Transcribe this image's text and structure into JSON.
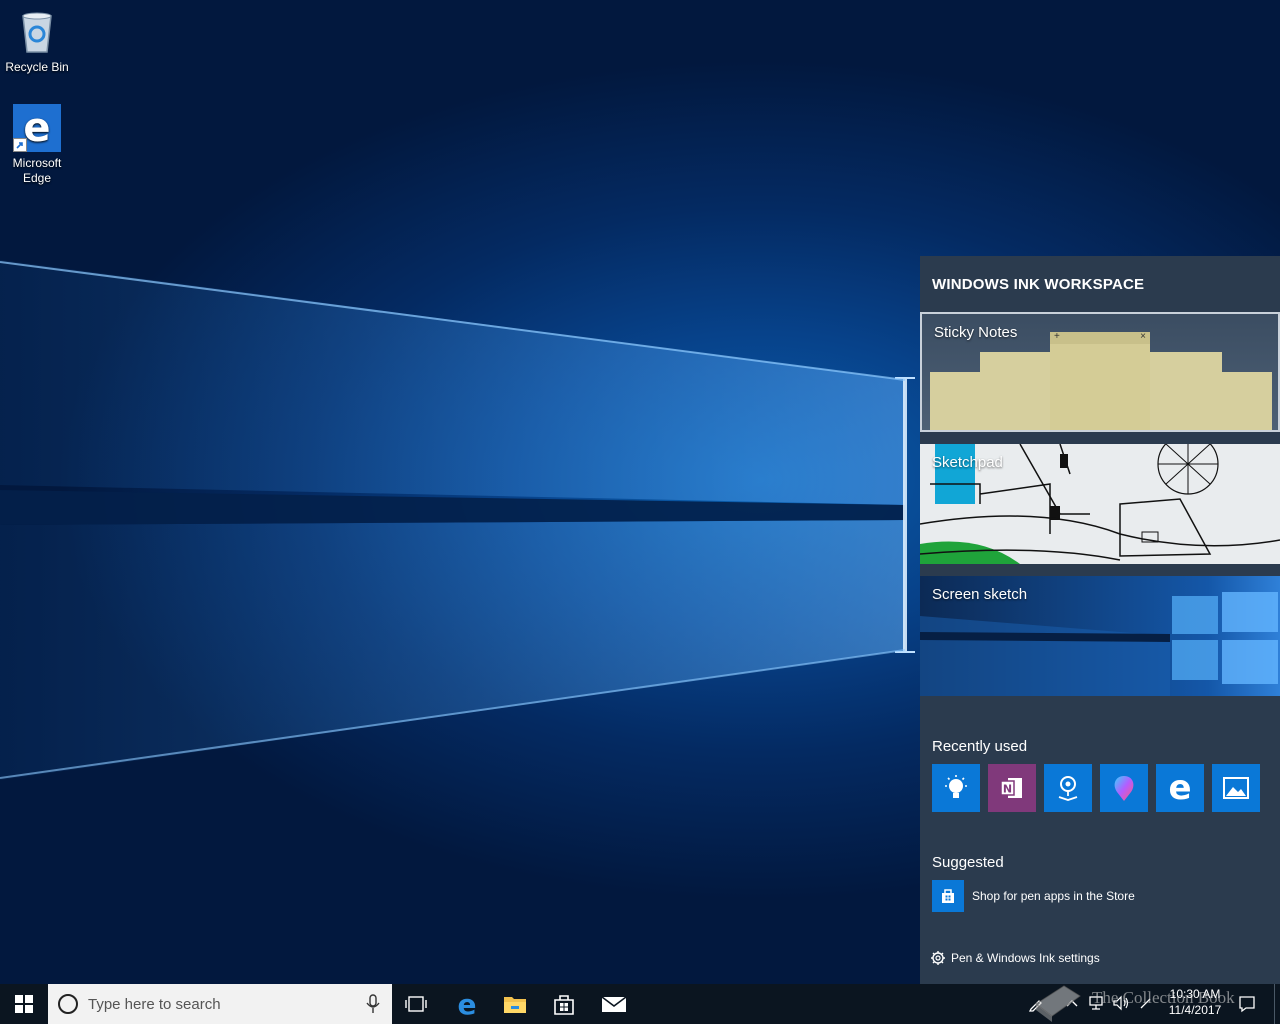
{
  "desktop": {
    "icons": [
      {
        "label": "Recycle Bin"
      },
      {
        "label": "Microsoft Edge"
      }
    ]
  },
  "ink_workspace": {
    "title": "WINDOWS INK WORKSPACE",
    "cards": [
      {
        "label": "Sticky Notes"
      },
      {
        "label": "Sketchpad"
      },
      {
        "label": "Screen sketch"
      }
    ],
    "sticky_note_glyphs": {
      "add": "+",
      "close": "×"
    },
    "recently_used_heading": "Recently used",
    "recently_used_icons": [
      "tips-icon",
      "onenote-icon",
      "maps-icon",
      "paint-3d-icon",
      "edge-icon",
      "photos-icon"
    ],
    "suggested_heading": "Suggested",
    "suggested_item": "Shop for pen apps in the Store",
    "settings_link": "Pen & Windows Ink settings"
  },
  "taskbar": {
    "search_placeholder": "Type here to search",
    "pinned": [
      "task-view-icon",
      "edge-icon",
      "file-explorer-icon",
      "store-icon",
      "mail-icon"
    ],
    "clock_time": "10:30 AM",
    "clock_date": "11/4/2017",
    "watermark": "The Collection Book"
  },
  "colors": {
    "accent": "#0a78d7",
    "panel_bg": "#2b3b4e",
    "taskbar_bg": "#0b1520",
    "sticky_note": "#d6cf9e"
  }
}
